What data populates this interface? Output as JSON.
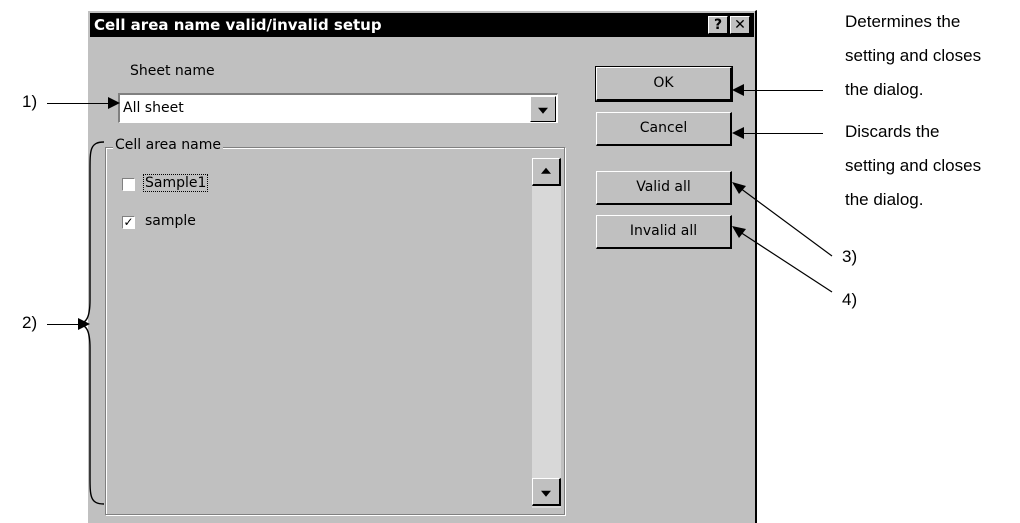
{
  "dialog": {
    "title": "Cell area name valid/invalid setup",
    "help_icon": "?",
    "close_icon": "✕",
    "sheet_label": "Sheet name",
    "sheet_value": "All sheet",
    "group_label": "Cell area name",
    "items": [
      {
        "label": "Sample1",
        "checked": false,
        "check_glyph": ""
      },
      {
        "label": "sample",
        "checked": true,
        "check_glyph": "✓"
      }
    ],
    "buttons": {
      "ok": "OK",
      "cancel": "Cancel",
      "valid_all": "Valid all",
      "invalid_all": "Invalid all"
    }
  },
  "annotations": {
    "label_1": "1)",
    "label_2": "2)",
    "label_3": "3)",
    "label_4": "4)",
    "ok_desc_1": "Determines the",
    "ok_desc_2": "setting and closes",
    "ok_desc_3": "the dialog.",
    "cancel_desc_1": "Discards the",
    "cancel_desc_2": "setting and closes",
    "cancel_desc_3": "the dialog."
  }
}
